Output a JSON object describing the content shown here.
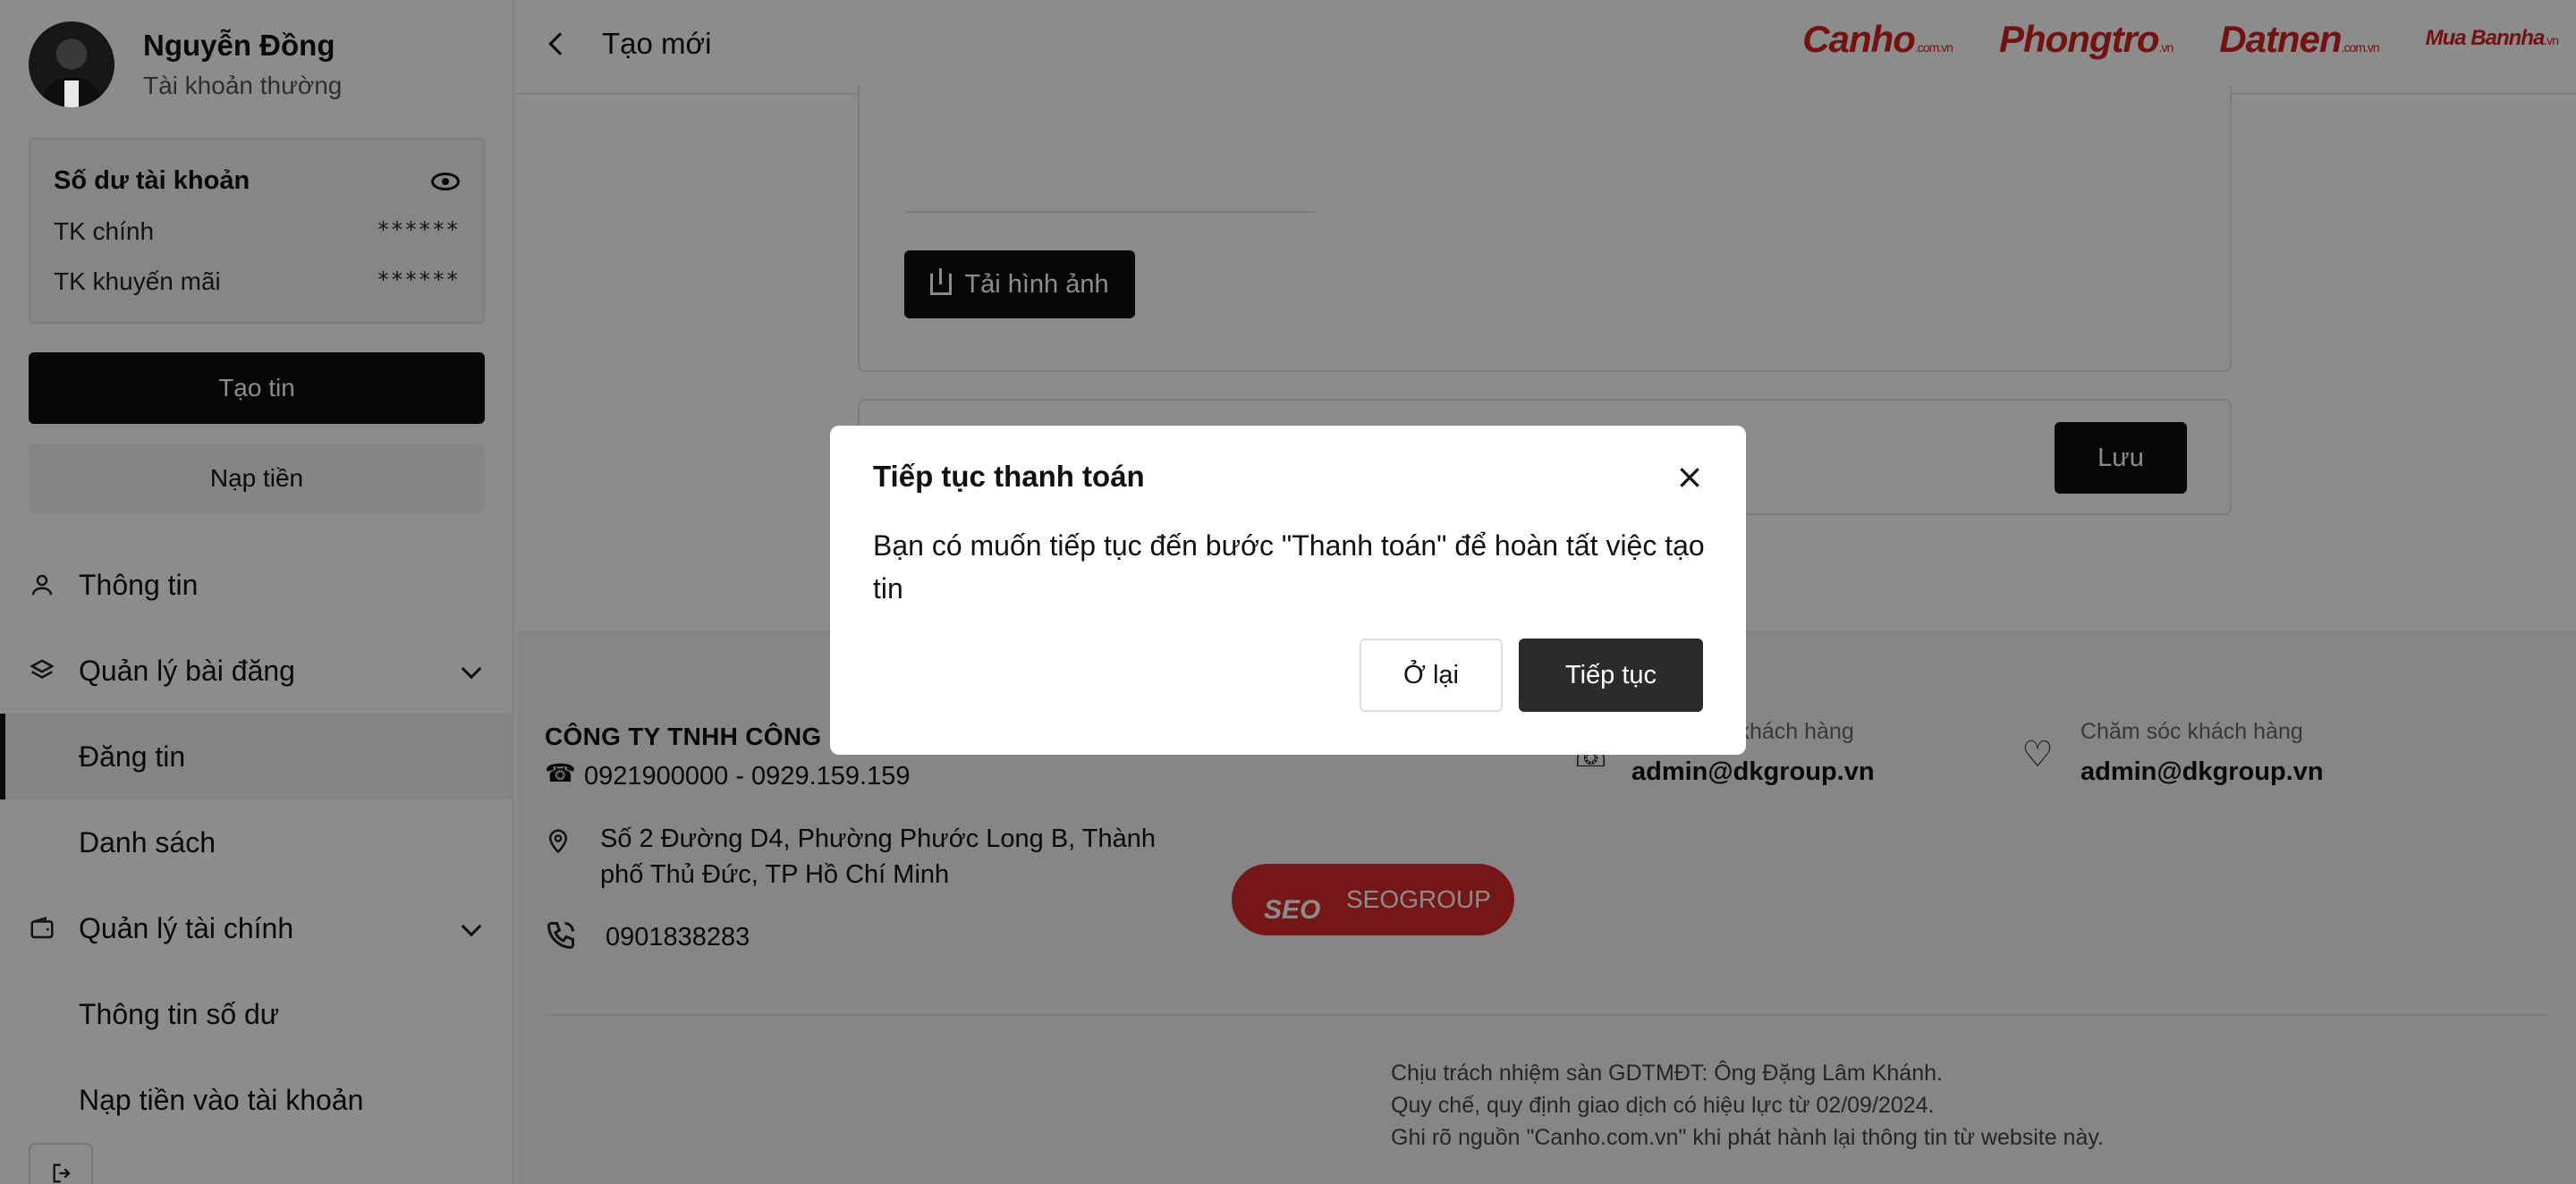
{
  "user": {
    "name": "Nguyễn Đồng",
    "account_type": "Tài khoản thường"
  },
  "balance": {
    "title": "Số dư tài khoản",
    "main_label": "TK chính",
    "main_value": "******",
    "promo_label": "TK khuyến mãi",
    "promo_value": "******"
  },
  "sidebar": {
    "create_label": "Tạo tin",
    "topup_label": "Nạp tiền",
    "items": [
      {
        "label": "Thông tin"
      },
      {
        "label": "Quản lý bài đăng"
      },
      {
        "label": "Đăng tin"
      },
      {
        "label": "Danh sách"
      },
      {
        "label": "Quản lý tài chính"
      },
      {
        "label": "Thông tin số dư"
      },
      {
        "label": "Nạp tiền vào tài khoản"
      }
    ]
  },
  "header": {
    "title": "Tạo mới",
    "brands": [
      {
        "name": "Canho",
        "suffix": ".com.vn"
      },
      {
        "name": "Phongtro",
        "suffix": ".vn"
      },
      {
        "name": "Datnen",
        "suffix": ".com.vn"
      },
      {
        "name": "Mua Bannha",
        "suffix": ".vn"
      }
    ]
  },
  "form": {
    "upload_label": "Tải hình ảnh",
    "save_label": "Lưu"
  },
  "footer": {
    "company": "CÔNG TY TNHH CÔNG NGHỆ",
    "phones": "0921900000 - 0929.159.159",
    "address": "Số 2 Đường D4, Phường Phước Long B, Thành phố Thủ Đức, TP Hồ Chí Minh",
    "hotline": "0901838283",
    "contact1_label": "Chăm sóc khách hàng",
    "contact1_value": "admin@dkgroup.vn",
    "contact2_label": "Chăm sóc khách hàng",
    "contact2_value": "admin@dkgroup.vn",
    "seo_label": "SEOGROUP",
    "seo_logo_text": "SEO",
    "legal_1": "Chịu trách nhiệm sàn GDTMĐT: Ông Đặng Lâm Khánh.",
    "legal_2": "Quy chế, quy định giao dịch có hiệu lực từ 02/09/2024.",
    "legal_3": "Ghi rõ nguồn \"Canho.com.vn\" khi phát hành lại thông tin từ website này."
  },
  "modal": {
    "title": "Tiếp tục thanh toán",
    "close_label": "×",
    "body": "Bạn có muốn tiếp tục đến bước \"Thanh toán\" để hoàn tất việc tạo tin",
    "back_label": "Ở lại",
    "continue_label": "Tiếp tục"
  },
  "colors": {
    "brand_red": "#d32222",
    "primary_button": "#0d0d0d",
    "overlay": "rgba(0,0,0,0.45)"
  }
}
